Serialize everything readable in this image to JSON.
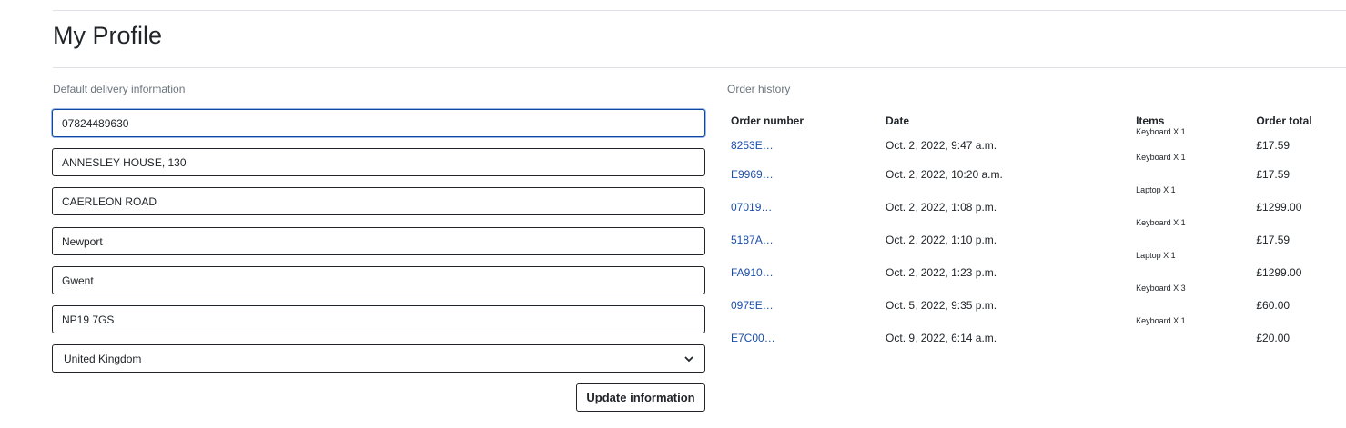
{
  "page": {
    "title": "My Profile"
  },
  "delivery": {
    "heading": "Default delivery information",
    "phone": "07824489630",
    "address_line1": "ANNESLEY HOUSE, 130",
    "address_line2": "CAERLEON ROAD",
    "town": "Newport",
    "county": "Gwent",
    "postcode": "NP19 7GS",
    "country": "United Kingdom",
    "update_label": "Update information"
  },
  "orders": {
    "heading": "Order history",
    "columns": {
      "number": "Order number",
      "date": "Date",
      "items": "Items",
      "total": "Order total"
    },
    "rows": [
      {
        "number": "8253E…",
        "date": "Oct. 2, 2022, 9:47 a.m.",
        "items": "Keyboard X 1",
        "total": "£17.59"
      },
      {
        "number": "E9969…",
        "date": "Oct. 2, 2022, 10:20 a.m.",
        "items": "Keyboard X 1",
        "total": "£17.59"
      },
      {
        "number": "07019…",
        "date": "Oct. 2, 2022, 1:08 p.m.",
        "items": "Laptop X 1",
        "total": "£1299.00"
      },
      {
        "number": "5187A…",
        "date": "Oct. 2, 2022, 1:10 p.m.",
        "items": "Keyboard X 1",
        "total": "£17.59"
      },
      {
        "number": "FA910…",
        "date": "Oct. 2, 2022, 1:23 p.m.",
        "items": "Laptop X 1",
        "total": "£1299.00"
      },
      {
        "number": "0975E…",
        "date": "Oct. 5, 2022, 9:35 p.m.",
        "items": "Keyboard X 3",
        "total": "£60.00"
      },
      {
        "number": "E7C00…",
        "date": "Oct. 9, 2022, 6:14 a.m.",
        "items": "Keyboard X 1",
        "total": "£20.00"
      }
    ]
  }
}
